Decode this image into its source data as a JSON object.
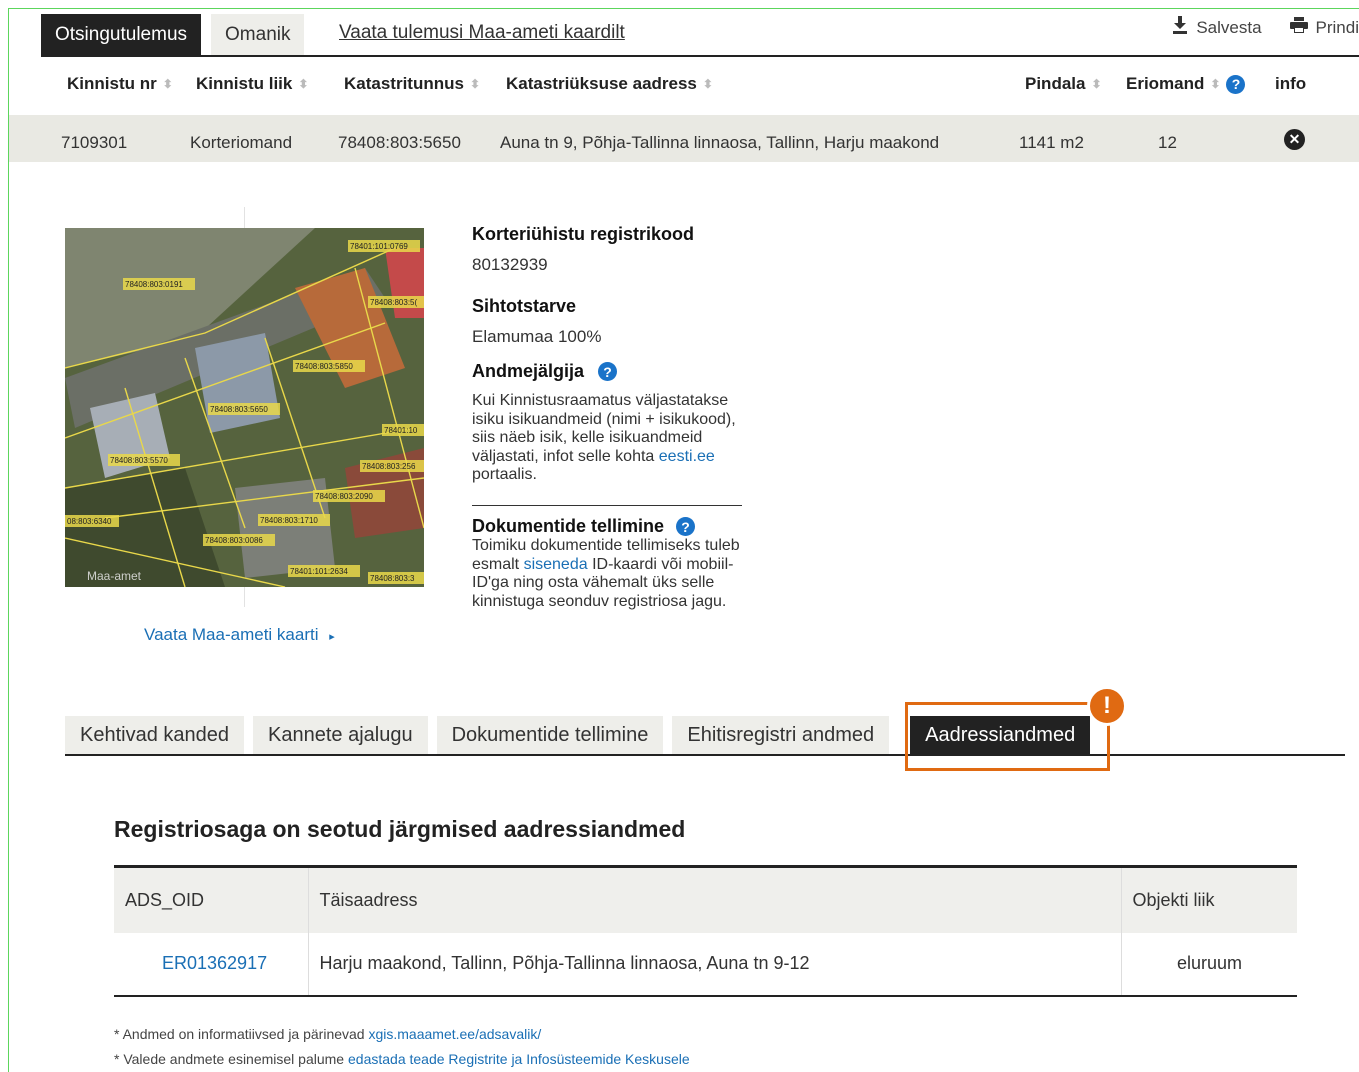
{
  "top_tabs": {
    "active": "Otsingutulemus",
    "inactive": "Omanik",
    "link": "Vaata tulemusi Maa-ameti kaardilt"
  },
  "actions": {
    "save": "Salvesta",
    "print": "Prindi"
  },
  "columns": {
    "nr": "Kinnistu nr",
    "type": "Kinnistu liik",
    "cadastral": "Katastritunnus",
    "address": "Katastriüksuse aadress",
    "area": "Pindala",
    "share": "Eriomand",
    "info": "info"
  },
  "result": {
    "nr": "7109301",
    "type": "Korteriomand",
    "cadastral": "78408:803:5650",
    "address": "Auna tn 9, Põhja-Tallinna linnaosa, Tallinn, Harju maakond",
    "area": "1141 m2",
    "share": "12"
  },
  "map": {
    "link": "Vaata Maa-ameti kaarti",
    "watermark": "Maa-amet",
    "parcels": [
      "78401:101:0769",
      "78408:803:0191",
      "78408:803:5(",
      "78408:803:5850",
      "78408:803:5650",
      "78401:10",
      "78408:803:5570",
      "78408:803:256",
      "78408:803:2090",
      "08:803:6340",
      "78408:803:1710",
      "78408:803:0086",
      "78401:101:2634",
      "78408:803:3"
    ]
  },
  "info": {
    "reg_heading": "Korteriühistu registrikood",
    "reg_value": "80132939",
    "purpose_heading": "Sihtotstarve",
    "purpose_value": "Elamumaa 100%",
    "tracker_heading": "Andmejälgija",
    "tracker_text_1": "Kui Kinnistusraamatus väljastatakse isiku isikuandmeid (nimi + isikukood), siis näeb isik, kelle isikuandmeid väljastati, infot selle kohta",
    "tracker_link": "eesti.ee",
    "tracker_text_2": "portaalis.",
    "docs_heading": "Dokumentide tellimine",
    "docs_text_1": "Toimiku dokumentide tellimiseks tuleb esmalt",
    "docs_link": "siseneda",
    "docs_text_2": "ID-kaardi või mobiil-ID'ga ning osta vähemalt üks selle kinnistuga seonduv registriosa jagu."
  },
  "bottom_tabs": [
    "Kehtivad kanded",
    "Kannete ajalugu",
    "Dokumentide tellimine",
    "Ehitisregistri andmed"
  ],
  "bottom_tab_active": "Aadressiandmed",
  "alert_badge": "!",
  "section_title": "Registriosaga on seotud järgmised aadressiandmed",
  "addr_table": {
    "headers": [
      "ADS_OID",
      "Täisaadress",
      "Objekti liik"
    ],
    "row": [
      "ER01362917",
      "Harju maakond, Tallinn, Põhja-Tallinna linnaosa, Auna tn 9-12",
      "eluruum"
    ]
  },
  "footnotes": {
    "f1_text": "* Andmed on informatiivsed ja pärinevad",
    "f1_link": "xgis.maaamet.ee/adsavalik/",
    "f2_text": "* Valede andmete esinemisel palume",
    "f2_link": "edastada teade Registrite ja Infosüsteemide Keskusele"
  },
  "colors": {
    "accent": "#e06a12",
    "link": "#1a6fb5",
    "dark": "#222222"
  }
}
